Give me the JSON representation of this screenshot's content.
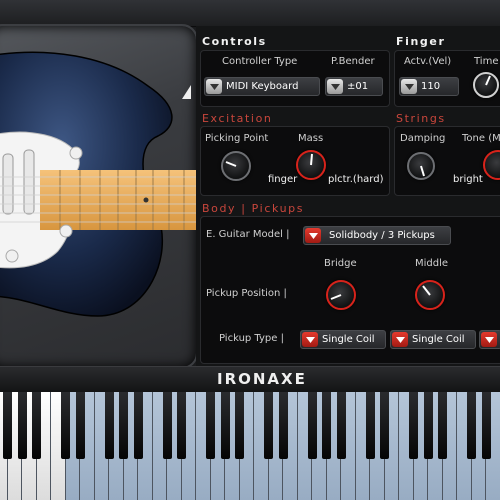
{
  "app": {
    "logo": "IRONAXE"
  },
  "controls": {
    "title": "Controls",
    "controller_type_label": "Controller Type",
    "controller_type_value": "MIDI Keyboard",
    "pbender_label": "P.Bender",
    "pbender_value": "±01"
  },
  "finger_sliding": {
    "title": "Finger Sliding",
    "activ_label": "Actv.(Vel)",
    "activ_value": "110",
    "time_label": "Time"
  },
  "excitation": {
    "title": "Excitation",
    "picking_point_label": "Picking Point",
    "picking_point_value": "finger",
    "mass_label": "Mass",
    "mass_value": "plctr.(hard)"
  },
  "strings": {
    "title": "Strings",
    "damping_label": "Damping",
    "tone_label": "Tone (M",
    "tone_value": "bright"
  },
  "body_pickups": {
    "title": "Body | Pickups",
    "model_label": "E. Guitar Model  |",
    "model_value": "Solidbody / 3 Pickups",
    "bridge_label": "Bridge",
    "middle_label": "Middle",
    "pickup_position_label": "Pickup Position  |",
    "pickup_type_label": "Pickup Type  |",
    "pickup_type_values": [
      "Single Coil",
      "Single Coil"
    ]
  },
  "colors": {
    "accent_red": "#d8231b",
    "section_red": "#c9463c",
    "blue_keys": "#a9bccf"
  },
  "icons": [
    "dropdown-arrow-icon",
    "knob"
  ]
}
